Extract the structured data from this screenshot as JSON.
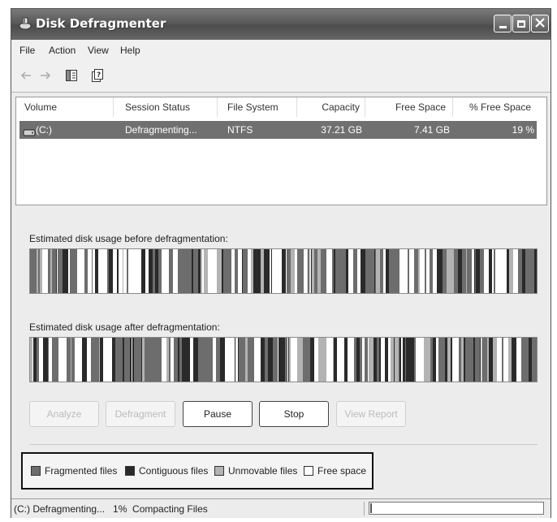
{
  "window": {
    "title": "Disk Defragmenter",
    "app_icon": "defrag-icon",
    "caption_buttons": [
      "minimize-icon",
      "maximize-icon",
      "close-icon"
    ]
  },
  "menu": [
    "File",
    "Action",
    "View",
    "Help"
  ],
  "toolbar": {
    "icons": [
      "back-arrow-icon",
      "forward-arrow-icon",
      "show-hide-pane-icon",
      "help-icon"
    ]
  },
  "volume_list": {
    "columns": [
      "Volume",
      "Session Status",
      "File System",
      "Capacity",
      "Free Space",
      "% Free Space"
    ],
    "rows": [
      {
        "volume": "(C:)",
        "status": "Defragmenting...",
        "fs": "NTFS",
        "capacity": "37.21 GB",
        "free": "7.41 GB",
        "free_pct": "19 %",
        "icon": "drive-icon"
      }
    ]
  },
  "before": {
    "label": "Estimated disk usage before defragmentation:"
  },
  "after": {
    "label": "Estimated disk usage after defragmentation:"
  },
  "buttons": {
    "analyze": "Analyze",
    "defragment": "Defragment",
    "pause": "Pause",
    "stop": "Stop",
    "view_report": "View Report"
  },
  "legend": [
    {
      "label": "Fragmented files",
      "color": "#6d6d6d"
    },
    {
      "label": "Contiguous files",
      "color": "#2a2a2a"
    },
    {
      "label": "Unmovable files",
      "color": "#b3b3b3"
    },
    {
      "label": "Free space",
      "color": "#ffffff"
    }
  ],
  "status": {
    "text": "(C:) Defragmenting...   1%  Compacting Files",
    "progress_fraction": 0.01
  }
}
